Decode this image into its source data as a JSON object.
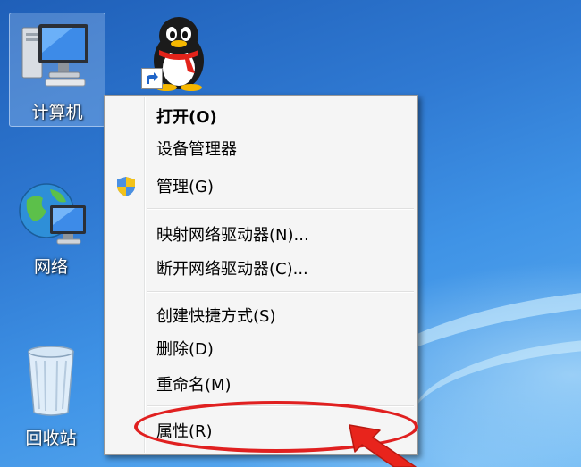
{
  "desktop": {
    "icons": [
      {
        "name": "computer",
        "label": "计算机"
      },
      {
        "name": "qq",
        "label": ""
      },
      {
        "name": "network",
        "label": "网络"
      },
      {
        "name": "recycle-bin",
        "label": "回收站"
      }
    ]
  },
  "context_menu": {
    "items": [
      {
        "label": "打开(O)",
        "bold": true
      },
      {
        "label": "设备管理器"
      },
      {
        "label": "管理(G)",
        "icon": "uac-shield-icon"
      },
      {
        "label": "映射网络驱动器(N)..."
      },
      {
        "label": "断开网络驱动器(C)..."
      },
      {
        "label": "创建快捷方式(S)"
      },
      {
        "label": "删除(D)"
      },
      {
        "label": "重命名(M)"
      },
      {
        "label": "属性(R)"
      }
    ]
  },
  "annotation": {
    "highlight_color": "#e02020",
    "highlighted_item": "属性(R)"
  },
  "colors": {
    "desktop_blue": "#2f79d2",
    "menu_background": "#f5f5f5"
  }
}
